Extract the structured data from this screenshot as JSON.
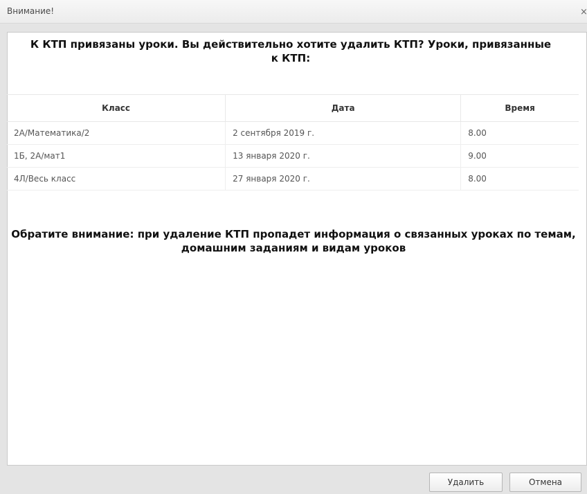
{
  "window": {
    "title": "Внимание!",
    "close_glyph": "×"
  },
  "dialog": {
    "heading": "К КТП привязаны уроки. Вы действительно хотите удалить КТП? Уроки, привязанные к КТП:",
    "table": {
      "columns": [
        "Класс",
        "Дата",
        "Время"
      ],
      "rows": [
        [
          "2А/Математика/2",
          "2 сентября 2019 г.",
          "8.00"
        ],
        [
          "1Б, 2А/мат1",
          "13 января 2020 г.",
          "9.00"
        ],
        [
          "4Л/Весь класс",
          "27 января 2020 г.",
          "8.00"
        ]
      ]
    },
    "note": "Обратите внимание: при удаление КТП пропадет информация о связанных уроках по темам, домашним заданиям и видам уроков"
  },
  "buttons": {
    "delete_label": "Удалить",
    "cancel_label": "Отмена"
  }
}
